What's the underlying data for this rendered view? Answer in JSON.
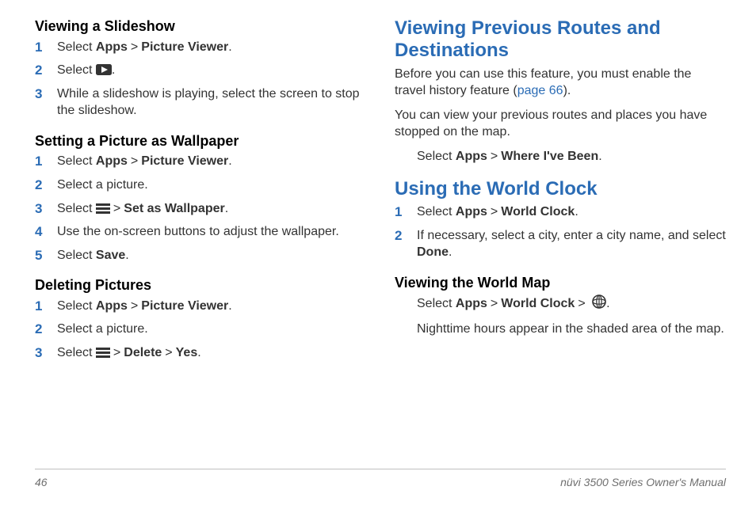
{
  "ui": {
    "gt": ">",
    "period": "."
  },
  "icons": {
    "play": "play-icon",
    "menu": "menu-icon",
    "globe": "globe-icon"
  },
  "left": {
    "slideshow": {
      "heading": "Viewing a Slideshow",
      "s1_pre": "Select ",
      "s1_b1": "Apps",
      "s1_b2": "Picture Viewer",
      "s2_pre": "Select ",
      "s3": "While a slideshow is playing, select the screen to stop the slideshow."
    },
    "wallpaper": {
      "heading": "Setting a Picture as Wallpaper",
      "s1_pre": "Select ",
      "s1_b1": "Apps",
      "s1_b2": "Picture Viewer",
      "s2": "Select a picture.",
      "s3_pre": "Select ",
      "s3_b1": "Set as Wallpaper",
      "s4": "Use the on-screen buttons to adjust the wallpaper.",
      "s5_pre": "Select ",
      "s5_b1": "Save"
    },
    "delete": {
      "heading": "Deleting Pictures",
      "s1_pre": "Select ",
      "s1_b1": "Apps",
      "s1_b2": "Picture Viewer",
      "s2": "Select a picture.",
      "s3_pre": "Select ",
      "s3_b1": "Delete",
      "s3_b2": "Yes"
    }
  },
  "right": {
    "routes": {
      "heading": "Viewing Previous Routes and Destinations",
      "p1_pre": "Before you can use this feature, you must enable the travel history feature (",
      "p1_link": "page 66",
      "p1_post": ").",
      "p2": "You can view your previous routes and places you have stopped on the map.",
      "step_pre": "Select ",
      "step_b1": "Apps",
      "step_b2": "Where I've Been"
    },
    "clock": {
      "heading": "Using the World Clock",
      "s1_pre": "Select ",
      "s1_b1": "Apps",
      "s1_b2": "World Clock",
      "s2_pre": "If necessary, select a city, enter a city name, and select ",
      "s2_b1": "Done"
    },
    "map": {
      "heading": "Viewing the World Map",
      "step_pre": "Select ",
      "step_b1": "Apps",
      "step_b2": "World Clock",
      "p1": "Nighttime hours appear in the shaded area of the map."
    }
  },
  "footer": {
    "page": "46",
    "doc": "nüvi 3500 Series Owner's Manual"
  }
}
